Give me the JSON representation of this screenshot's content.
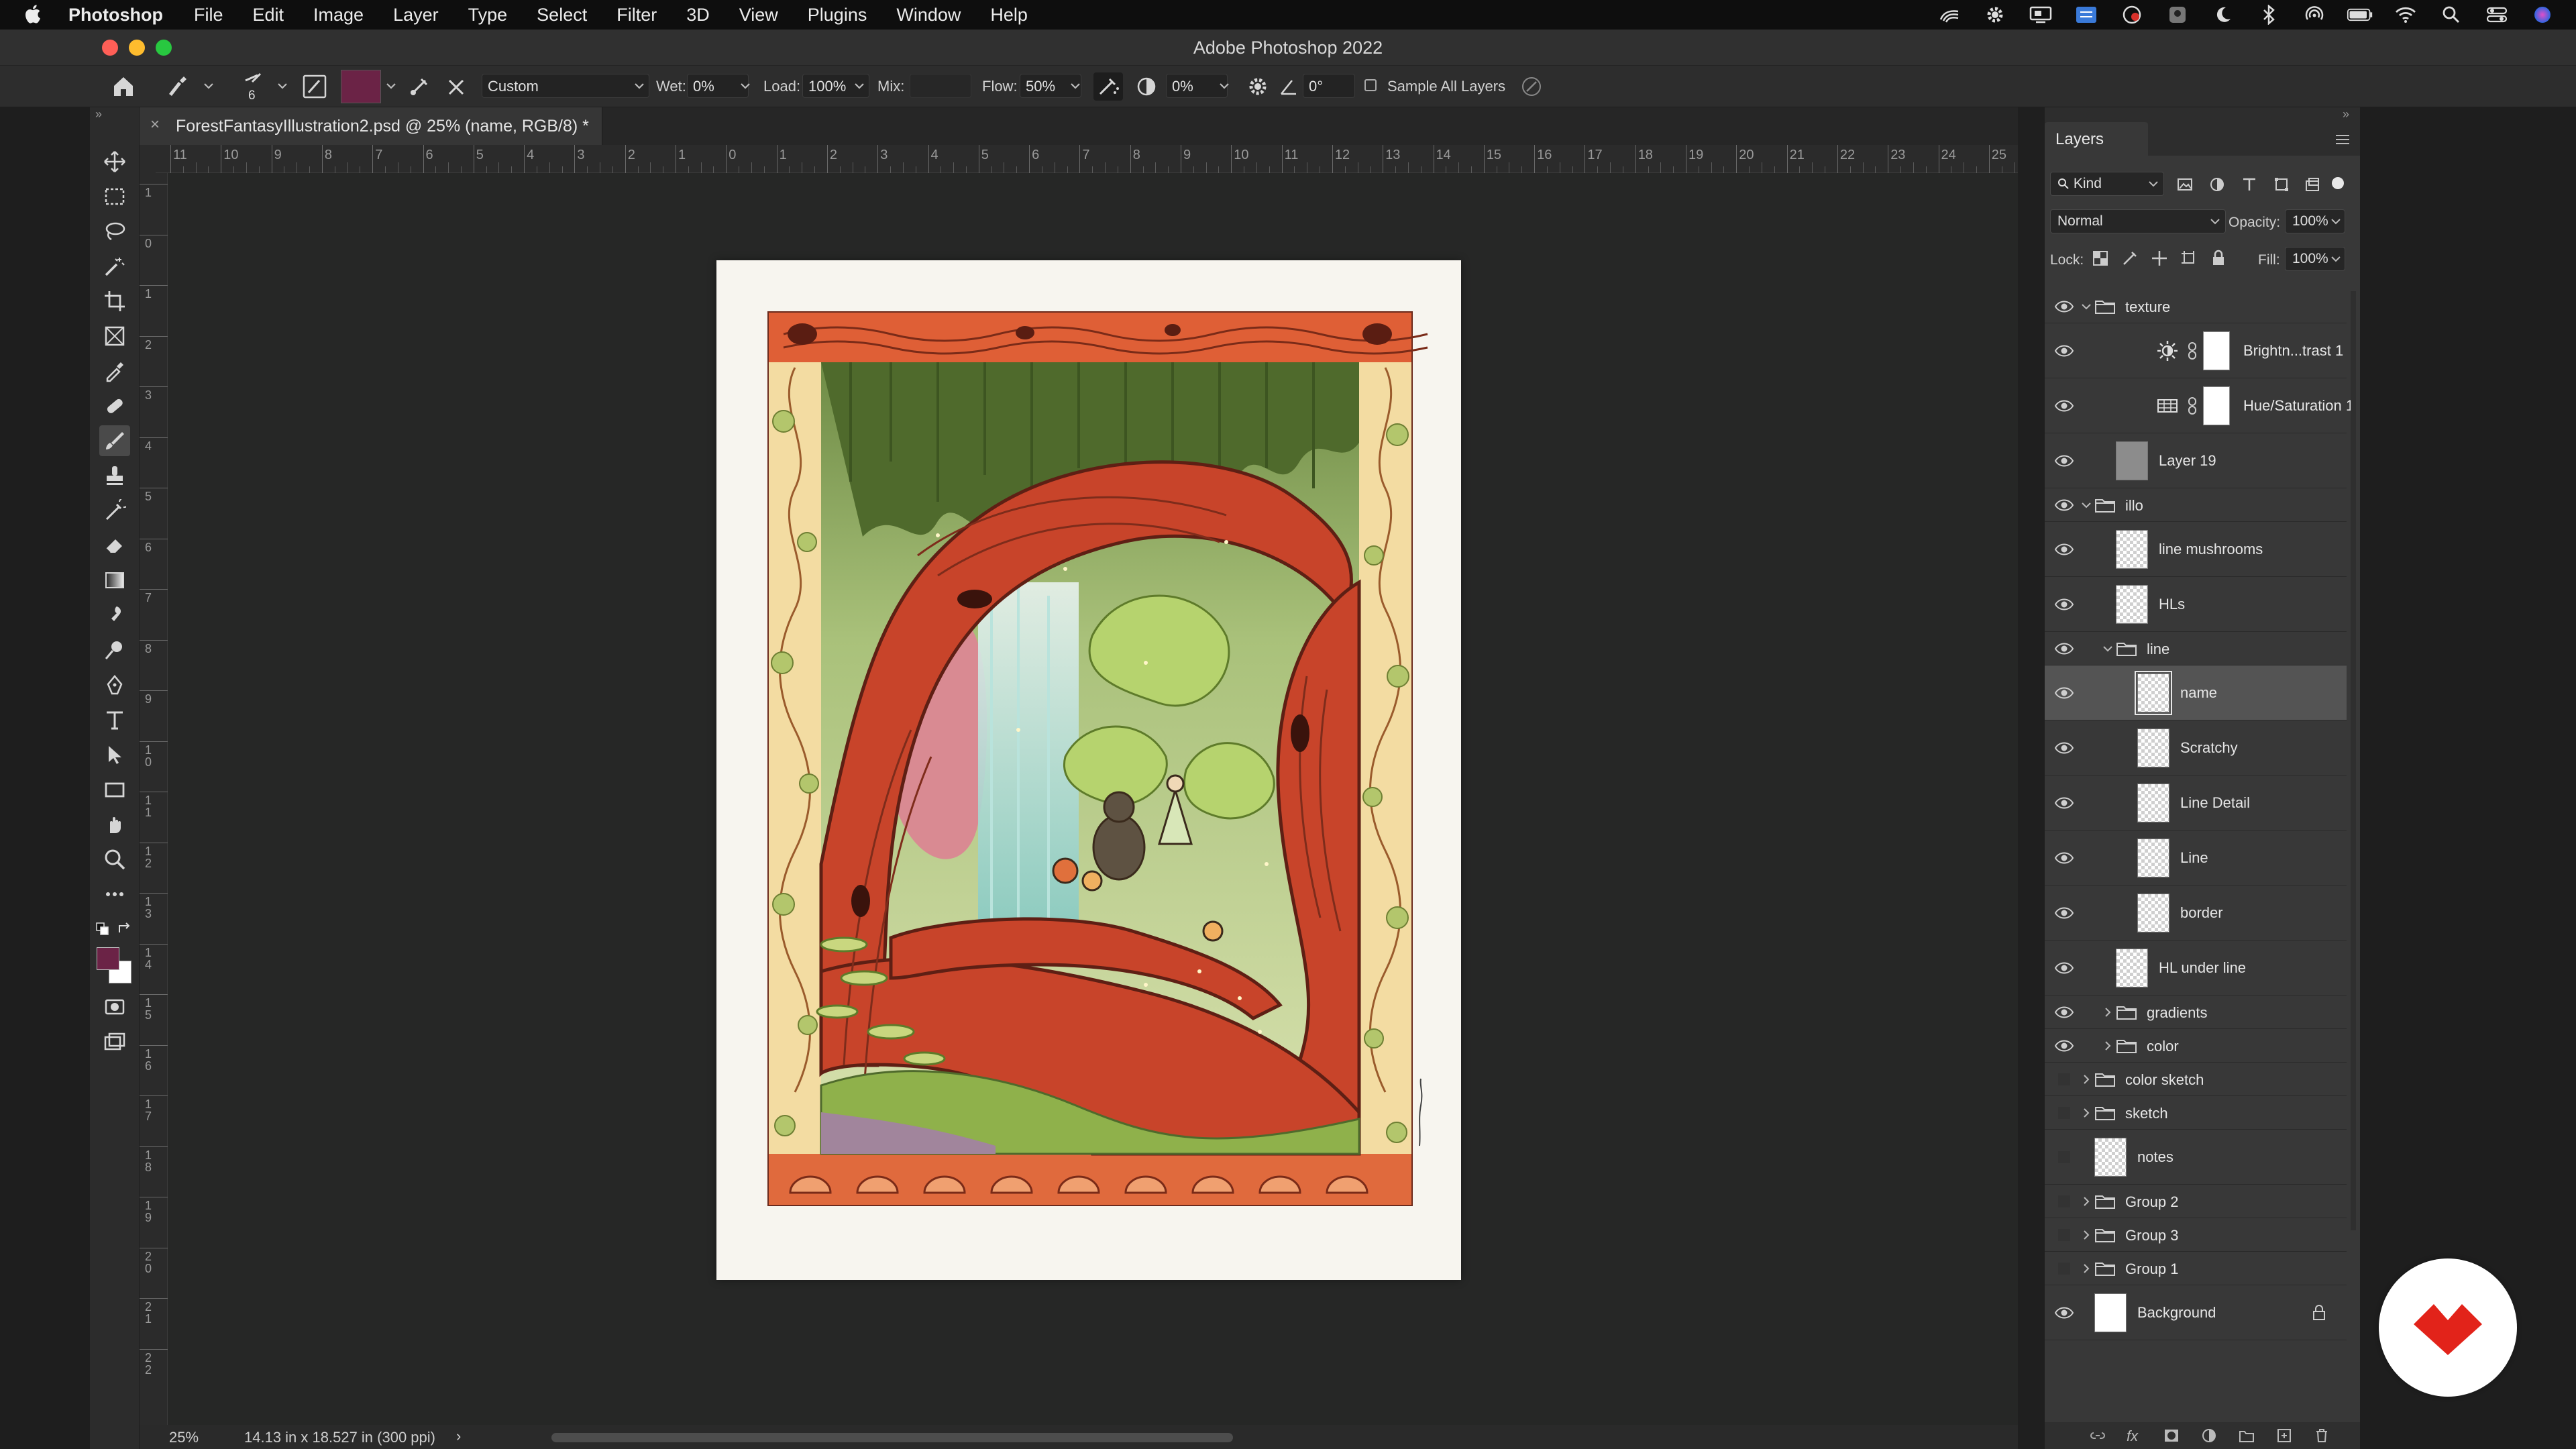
{
  "menubar": {
    "app_name": "Photoshop",
    "items": [
      "File",
      "Edit",
      "Image",
      "Layer",
      "Type",
      "Select",
      "Filter",
      "3D",
      "View",
      "Plugins",
      "Window",
      "Help"
    ]
  },
  "window": {
    "title": "Adobe Photoshop 2022"
  },
  "options": {
    "brush_size": "6",
    "brush_color": "#6b2346",
    "preset": "Custom",
    "wet_label": "Wet:",
    "wet_value": "0%",
    "load_label": "Load:",
    "load_value": "100%",
    "mix_label": "Mix:",
    "mix_value": "",
    "flow_label": "Flow:",
    "flow_value": "50%",
    "smoothing_value": "0%",
    "angle_value": "0°",
    "sample_all_label": "Sample All Layers"
  },
  "document": {
    "tab_title": "ForestFantasyIllustration2.psd @ 25% (name, RGB/8) *",
    "zoom": "25%",
    "doc_info": "14.13 in x 18.527 in (300 ppi)"
  },
  "rulers": {
    "horizontal": [
      "11",
      "10",
      "9",
      "8",
      "7",
      "6",
      "5",
      "4",
      "3",
      "2",
      "1",
      "0",
      "1",
      "2",
      "3",
      "4",
      "5",
      "6",
      "7",
      "8",
      "9",
      "10",
      "11",
      "12",
      "13",
      "14",
      "15",
      "16",
      "17",
      "18",
      "19",
      "20",
      "21",
      "22",
      "23",
      "24",
      "25"
    ],
    "vertical": [
      "1",
      "0",
      "1",
      "2",
      "3",
      "4",
      "5",
      "6",
      "7",
      "8",
      "9",
      "10",
      "11",
      "12",
      "13",
      "14",
      "15",
      "16",
      "17",
      "18",
      "19",
      "20",
      "21",
      "22"
    ]
  },
  "colors": {
    "foreground": "#6b2346",
    "background": "#ffffff",
    "accent": "#2d8ceb",
    "brand": "#e2231a"
  },
  "layers_panel": {
    "tab": "Layers",
    "filter_kind": "Kind",
    "blend_mode": "Normal",
    "opacity_label": "Opacity:",
    "opacity_value": "100%",
    "lock_label": "Lock:",
    "fill_label": "Fill:",
    "fill_value": "100%",
    "layers": [
      {
        "name": "texture",
        "type": "group",
        "visible": true,
        "expanded": true,
        "indent": 0
      },
      {
        "name": "Brightn...trast 1",
        "type": "adjust-brightness",
        "visible": true,
        "indent": 1
      },
      {
        "name": "Hue/Saturation 1",
        "type": "adjust-hue",
        "visible": true,
        "indent": 1
      },
      {
        "name": "Layer 19",
        "type": "pixel-gray",
        "visible": true,
        "indent": 1
      },
      {
        "name": "illo",
        "type": "group",
        "visible": true,
        "expanded": true,
        "indent": 0
      },
      {
        "name": "line mushrooms",
        "type": "pixel",
        "visible": true,
        "indent": 1
      },
      {
        "name": "HLs",
        "type": "pixel",
        "visible": true,
        "indent": 1
      },
      {
        "name": "line",
        "type": "group",
        "visible": true,
        "expanded": true,
        "indent": 1
      },
      {
        "name": "name",
        "type": "pixel",
        "visible": true,
        "indent": 2,
        "selected": true
      },
      {
        "name": "Scratchy",
        "type": "pixel",
        "visible": true,
        "indent": 2
      },
      {
        "name": "Line Detail",
        "type": "pixel",
        "visible": true,
        "indent": 2
      },
      {
        "name": "Line",
        "type": "pixel",
        "visible": true,
        "indent": 2
      },
      {
        "name": "border",
        "type": "pixel",
        "visible": true,
        "indent": 2
      },
      {
        "name": "HL under line",
        "type": "pixel",
        "visible": true,
        "indent": 1
      },
      {
        "name": "gradients",
        "type": "group",
        "visible": true,
        "expanded": false,
        "indent": 1
      },
      {
        "name": "color",
        "type": "group",
        "visible": true,
        "expanded": false,
        "indent": 1
      },
      {
        "name": "color sketch",
        "type": "group",
        "visible": false,
        "expanded": false,
        "indent": 0
      },
      {
        "name": "sketch",
        "type": "group",
        "visible": false,
        "expanded": false,
        "indent": 0
      },
      {
        "name": "notes",
        "type": "pixel",
        "visible": false,
        "indent": 0
      },
      {
        "name": "Group 2",
        "type": "group",
        "visible": false,
        "expanded": false,
        "indent": 0
      },
      {
        "name": "Group 3",
        "type": "group",
        "visible": false,
        "expanded": false,
        "indent": 0
      },
      {
        "name": "Group 1",
        "type": "group",
        "visible": false,
        "expanded": false,
        "indent": 0
      },
      {
        "name": "Background",
        "type": "pixel-white",
        "visible": true,
        "indent": 0,
        "locked": true
      }
    ]
  }
}
